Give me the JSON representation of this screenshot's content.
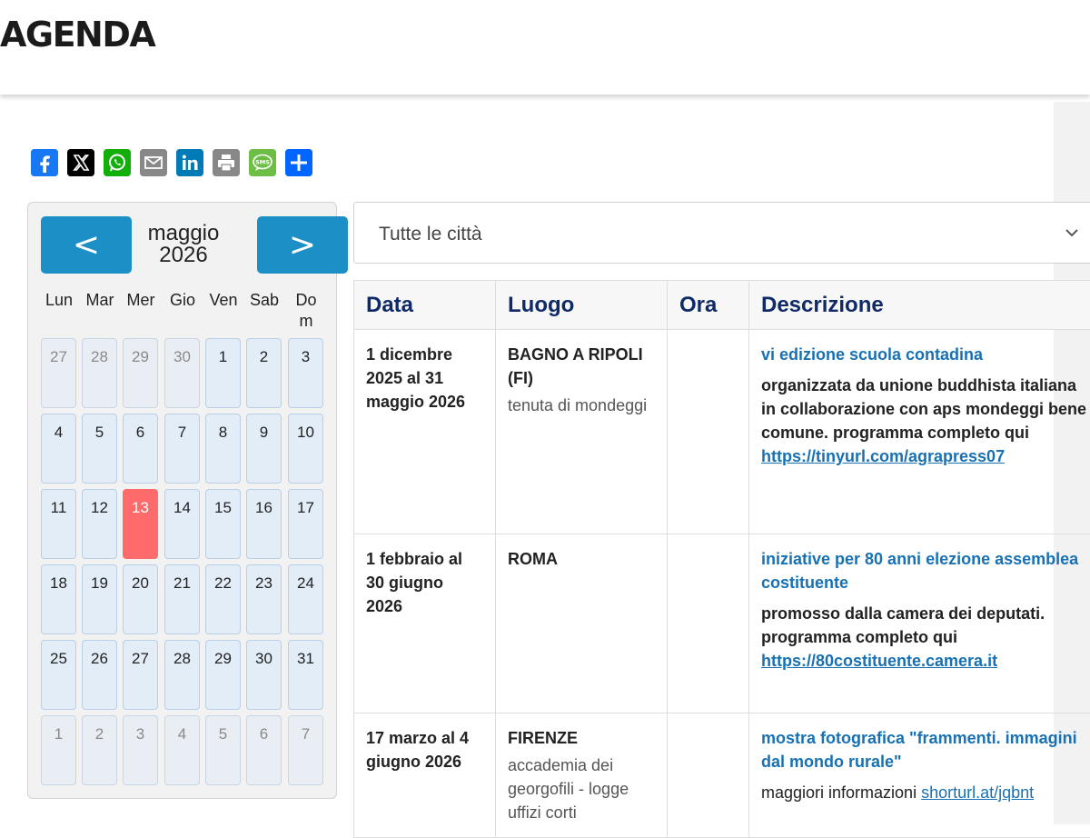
{
  "page": {
    "title": "AGENDA"
  },
  "share_icons": [
    {
      "icon": "facebook-icon",
      "color": "#1877f2"
    },
    {
      "icon": "x-icon",
      "color": "#000000"
    },
    {
      "icon": "whatsapp-icon",
      "color": "#12af0a"
    },
    {
      "icon": "email-icon",
      "color": "#888888"
    },
    {
      "icon": "linkedin-icon",
      "color": "#007bb5"
    },
    {
      "icon": "print-icon",
      "color": "#888888"
    },
    {
      "icon": "sms-icon",
      "color": "#6cbe45"
    },
    {
      "icon": "share-icon",
      "color": "#0166ff"
    }
  ],
  "calendar": {
    "prev_label": "<",
    "next_label": ">",
    "month": "maggio",
    "year": "2026",
    "weekdays": [
      "Lun",
      "Mar",
      "Mer",
      "Gio",
      "Ven",
      "Sab",
      "Do\nm"
    ],
    "weeks": [
      [
        "27",
        "28",
        "29",
        "30",
        "1",
        "2",
        "3"
      ],
      [
        "4",
        "5",
        "6",
        "7",
        "8",
        "9",
        "10"
      ],
      [
        "11",
        "12",
        "13",
        "14",
        "15",
        "16",
        "17"
      ],
      [
        "18",
        "19",
        "20",
        "21",
        "22",
        "23",
        "24"
      ],
      [
        "25",
        "26",
        "27",
        "28",
        "29",
        "30",
        "31"
      ],
      [
        "1",
        "2",
        "3",
        "4",
        "5",
        "6",
        "7"
      ]
    ],
    "today": "13",
    "colors": {
      "nav": "#1b8fc6",
      "today": "#ff6b6b",
      "day_bg": "#e3edf8"
    }
  },
  "city_filter": {
    "value": "Tutte le città"
  },
  "table": {
    "headers": {
      "data": "Data",
      "luogo": "Luogo",
      "ora": "Ora",
      "descrizione": "Descrizione"
    },
    "rows": [
      {
        "date": "1 dicembre 2025 al 31 maggio 2026",
        "city": "BAGNO A RIPOLI (FI)",
        "venue": "tenuta di mondeggi",
        "time": "",
        "title": "vi edizione scuola contadina",
        "description": "organizzata da unione buddhista italiana in collaborazione con aps mondeggi bene comune. programma completo qui",
        "link": "https://tinyurl.com/agrapress07"
      },
      {
        "date": "1 febbraio al 30 giugno 2026",
        "city": "ROMA",
        "venue": "",
        "time": "",
        "title": "iniziative per 80 anni elezione assemblea costituente",
        "description": "promosso dalla camera dei deputati. programma completo qui",
        "link": "https://80costituente.camera.it"
      },
      {
        "date": "17 marzo al 4 giugno 2026",
        "city": "FIRENZE",
        "venue": "accademia dei georgofili - logge uffizi corti",
        "time": "",
        "title": "mostra fotografica \"frammenti. immagini dal mondo rurale\"",
        "description": "maggiori informazioni",
        "link": "shorturl.at/jqbnt"
      }
    ]
  }
}
